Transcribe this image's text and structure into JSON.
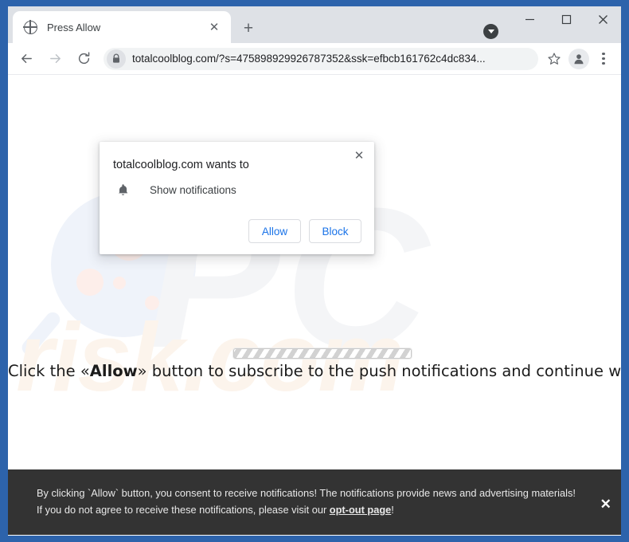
{
  "window": {
    "frame_color": "#2d63ab",
    "controls": {
      "dropdown_badge": "chevron-down",
      "minimize": "—",
      "maximize": "□",
      "close": "✕"
    }
  },
  "tabstrip": {
    "tab": {
      "title": "Press Allow",
      "favicon": "globe-icon",
      "close_label": "✕"
    },
    "new_tab_label": "+"
  },
  "toolbar": {
    "back_label": "←",
    "forward_label": "→",
    "reload_label": "⟳",
    "lock_icon": "lock-icon",
    "url": "totalcoolblog.com/?s=475898929926787352&ssk=efbcb161762c4dc834...",
    "bookmark_icon": "star-icon",
    "profile_icon": "account-avatar-icon",
    "menu_icon": "three-dot-menu-icon"
  },
  "permission_dialog": {
    "title": "totalcoolblog.com wants to",
    "permission_icon": "bell-icon",
    "permission_label": "Show notifications",
    "allow_label": "Allow",
    "block_label": "Block",
    "close_label": "✕",
    "accent_color": "#1a73e8"
  },
  "page": {
    "loader": "striped-progress-bar",
    "headline_prefix": "Click the «Allow»",
    "headline_bold": "Allow",
    "headline_pre": "Click the «",
    "headline_post": "» button to subscribe to the push notifications and continue watching",
    "watermark_pc": "PC",
    "watermark_risk": "risk.com"
  },
  "banner": {
    "text_part1": "By clicking `Allow` button, you consent to receive notifications! The notifications provide news and advertising materials! If you do not agree to receive these notifications, please visit our ",
    "link_label": "opt-out page",
    "text_part2": "!",
    "close_label": "✕",
    "background_color": "#333333"
  }
}
